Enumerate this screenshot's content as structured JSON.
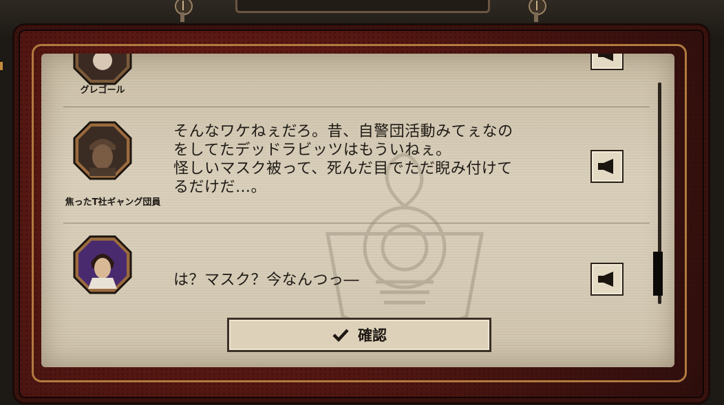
{
  "dialog_log": {
    "entries": [
      {
        "speaker": "グレゴール",
        "text": "",
        "voice_icon": "speaker-icon"
      },
      {
        "speaker": "焦ったT社ギャング団員",
        "text": "そんなワケねぇだろ。昔、自警団活動みてぇなの\nをしてたデッドラビッツはもういねぇ。\n怪しいマスク被って、死んだ目でただ睨み付けて\nるだけだ…。",
        "voice_icon": "speaker-icon"
      },
      {
        "speaker": "",
        "text": "は？マスク？今なんつっ―",
        "voice_icon": "speaker-icon"
      }
    ]
  },
  "confirm_button": {
    "label": "確認",
    "icon": "checkmark-icon"
  },
  "colors": {
    "frame_red": "#4b1511",
    "frame_gold": "#b27b3f",
    "paper": "#d6ccb7",
    "text": "#1e1a15"
  }
}
